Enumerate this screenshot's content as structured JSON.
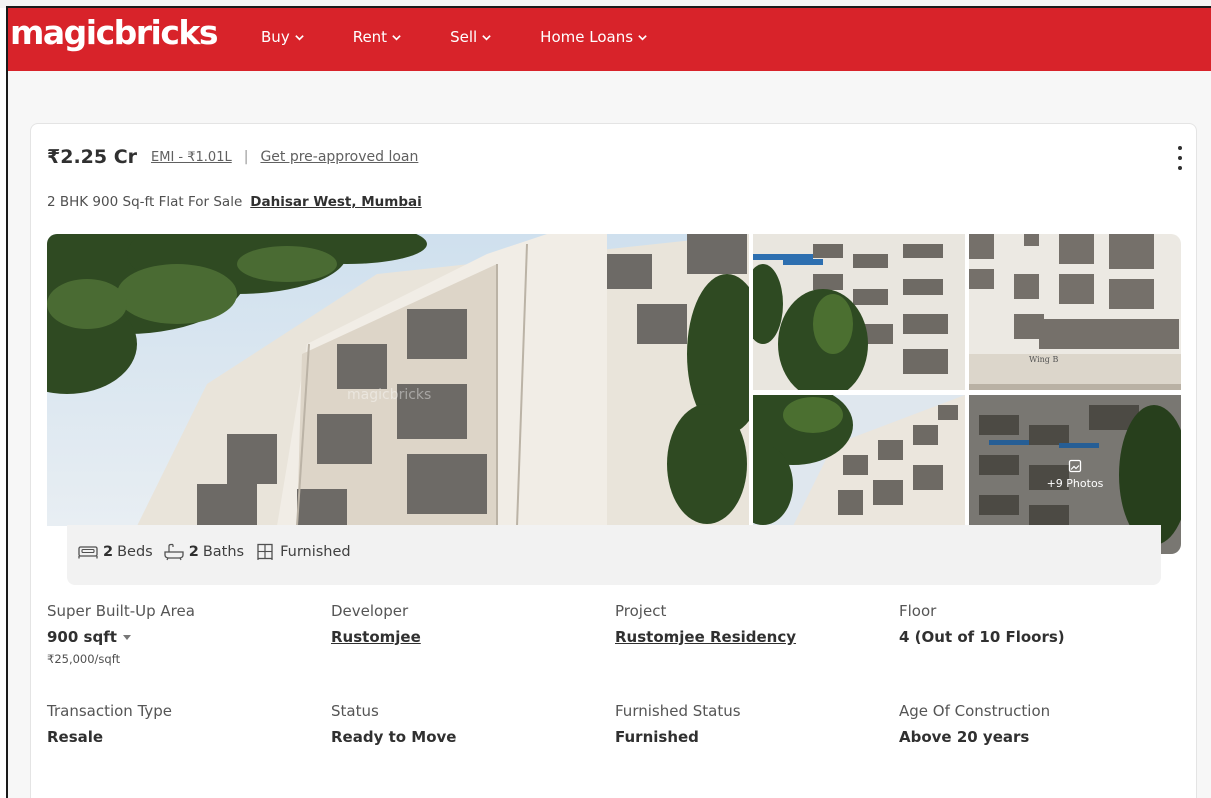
{
  "brand": {
    "logo": "magicbricks",
    "color": "#d8232a"
  },
  "nav": {
    "items": [
      {
        "label": "Buy"
      },
      {
        "label": "Rent"
      },
      {
        "label": "Sell"
      },
      {
        "label": "Home Loans"
      }
    ]
  },
  "listing": {
    "price": "₹2.25 Cr",
    "emi": "EMI - ₹1.01L",
    "separator": "|",
    "loan_link": "Get pre-approved loan",
    "title": "2 BHK 900 Sq-ft Flat For Sale",
    "locality": "Dahisar West, Mumbai",
    "gallery": {
      "more_photos": "+9 Photos",
      "watermark": "magicbricks"
    },
    "amenities": {
      "beds_count": "2",
      "beds_label": "Beds",
      "baths_count": "2",
      "baths_label": "Baths",
      "furnishing": "Furnished"
    },
    "facts": [
      {
        "label": "Super Built-Up Area",
        "value": "900 sqft",
        "sub": "₹25,000/sqft"
      },
      {
        "label": "Developer",
        "value": "Rustomjee"
      },
      {
        "label": "Project",
        "value": "Rustomjee Residency"
      },
      {
        "label": "Floor",
        "value": "4 (Out of 10 Floors)"
      },
      {
        "label": "Transaction Type",
        "value": "Resale"
      },
      {
        "label": "Status",
        "value": "Ready to Move"
      },
      {
        "label": "Furnished Status",
        "value": "Furnished"
      },
      {
        "label": "Age Of Construction",
        "value": "Above 20 years"
      }
    ]
  }
}
